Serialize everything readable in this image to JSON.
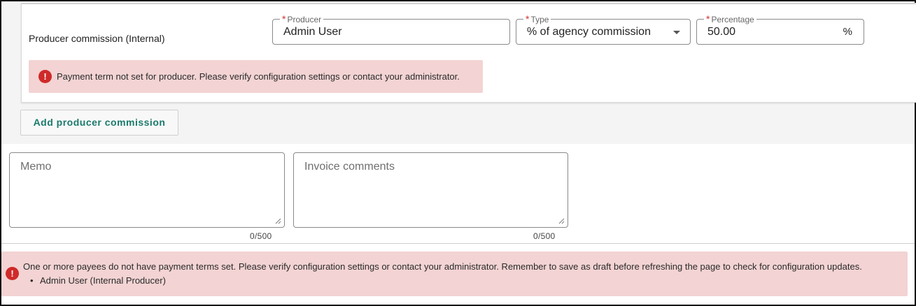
{
  "commission": {
    "row_label": "Producer commission (Internal)",
    "producer": {
      "label": "Producer",
      "required_mark": "*",
      "value": "Admin User"
    },
    "type": {
      "label": "Type",
      "required_mark": "*",
      "value": "% of agency commission"
    },
    "percentage": {
      "label": "Percentage",
      "required_mark": "*",
      "value": "50.00",
      "suffix": "%"
    },
    "error": {
      "icon": "error-icon",
      "message": "Payment term not set for producer. Please verify configuration settings or contact your administrator."
    }
  },
  "add_button": {
    "label": "Add producer commission"
  },
  "memo": {
    "placeholder": "Memo",
    "counter": "0/500"
  },
  "invoice_comments": {
    "placeholder": "Invoice comments",
    "counter": "0/500"
  },
  "bottom_alert": {
    "icon": "error-icon",
    "message": "One or more payees do not have payment terms set. Please verify configuration settings or contact your administrator. Remember to save as draft before refreshing the page to check for configuration updates.",
    "items": [
      "Admin User (Internal Producer)"
    ]
  },
  "colors": {
    "required": "#d32f2f",
    "error_bg": "#f3d3d3",
    "error_icon": "#cf2a2a",
    "accent": "#1b7a6c"
  }
}
